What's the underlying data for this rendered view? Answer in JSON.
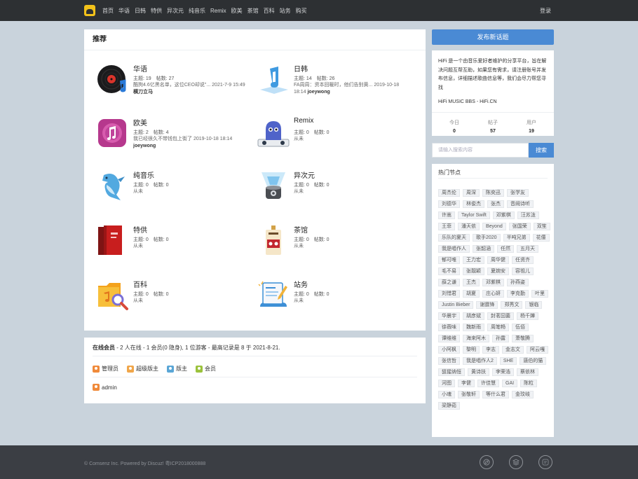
{
  "nav": {
    "items": [
      "首页",
      "华语",
      "日韩",
      "特供",
      "异次元",
      "纯音乐",
      "Remix",
      "欧美",
      "茶馆",
      "百科",
      "站务",
      "购买"
    ],
    "login": "登录"
  },
  "main": {
    "title": "推荐",
    "forums": [
      {
        "name": "华语",
        "stats": "主题: 19　帖数: 27",
        "last": "酷狗4.6亿黑名单，这位CEO却说\"... 2021-7-9 15:49",
        "user": "横刀立马",
        "icon": "vinyl-record-icon"
      },
      {
        "name": "日韩",
        "stats": "主题: 14　帖数: 26",
        "last": "FA周周：资本回暖时，他们告别黄... 2019-10-18 18:14",
        "user": "joeywong",
        "icon": "music-note-icon"
      },
      {
        "name": "欧美",
        "stats": "主题: 2　帖数: 4",
        "last": "我已经很久不带钱包上街了 2019-10-18 18:14",
        "user": "joeywong",
        "icon": "itunes-icon"
      },
      {
        "name": "Remix",
        "stats": "主题: 0　帖数: 0",
        "last": "从未",
        "user": "",
        "icon": "dj-ghost-icon"
      },
      {
        "name": "纯音乐",
        "stats": "主题: 0　帖数: 0",
        "last": "从未",
        "user": "",
        "icon": "dolphin-icon"
      },
      {
        "name": "异次元",
        "stats": "主题: 0　帖数: 0",
        "last": "从未",
        "user": "",
        "icon": "hologram-speaker-icon"
      },
      {
        "name": "特供",
        "stats": "主题: 0　帖数: 0",
        "last": "从未",
        "user": "",
        "icon": "red-book-icon"
      },
      {
        "name": "茶馆",
        "stats": "主题: 0　帖数: 0",
        "last": "从未",
        "user": "",
        "icon": "cassette-icon"
      },
      {
        "name": "百科",
        "stats": "主题: 0　帖数: 0",
        "last": "从未",
        "user": "",
        "icon": "folder-search-icon"
      },
      {
        "name": "站务",
        "stats": "主题: 0　帖数: 0",
        "last": "从未",
        "user": "",
        "icon": "document-pen-icon"
      }
    ]
  },
  "online": {
    "label": "在线会员",
    "summary": " - 2 人在线 - 1 会员(0 隐身), 1 位游客 - 最高记录是 8 于 2021-8-21.",
    "roles": [
      {
        "label": "管理员",
        "color": "#f08a3a"
      },
      {
        "label": "超级版主",
        "color": "#f0a64a"
      },
      {
        "label": "版主",
        "color": "#5aa6d6"
      },
      {
        "label": "会员",
        "color": "#9bc23c"
      }
    ],
    "member": "admin"
  },
  "sidebar": {
    "post_button": "发布新话题",
    "intro": "HiFi 是一个由音乐爱好者维护的分享平台，旨在解决问题互帮互助，如果您有需求，请注册账号并发布信息，详细描述歌曲信息等，我们会尽力帮您寻找",
    "site": "HiFi MUSIC BBS - HiFi.CN",
    "stats": [
      {
        "label": "今日",
        "value": "0"
      },
      {
        "label": "帖子",
        "value": "57"
      },
      {
        "label": "用户",
        "value": "19"
      }
    ],
    "search_placeholder": "请输入搜索内容",
    "search_button": "搜索",
    "hot_title": "热门节点",
    "tags": [
      "周杰伦",
      "周深",
      "陈奕迅",
      "张学友",
      "刘德华",
      "林俊杰",
      "张杰",
      "音阙诗听",
      "许嵩",
      "Taylor Swift",
      "邓紫棋",
      "汪苏泷",
      "王菲",
      "潘天依",
      "Beyond",
      "张国荣",
      "双笙",
      "乐队的夏天",
      "歌手2020",
      "半吨兄弟",
      "花僮",
      "我是唱作人",
      "张韶涵",
      "任然",
      "五月天",
      "郁可唯",
      "王力宏",
      "周华健",
      "任贤齐",
      "毛不易",
      "张靓颖",
      "夏婉安",
      "容祖儿",
      "薛之谦",
      "王杰",
      "邓紫棋",
      "孙燕姿",
      "刘惜君",
      "胡夏",
      "庄心妍",
      "李克勤",
      "叶里",
      "Justin Bieber",
      "谢霆锋",
      "郑秀文",
      "银临",
      "华晨宇",
      "胡彦斌",
      "封茗囧菌",
      "杨千嬅",
      "徐薇味",
      "魏新雨",
      "周笔畅",
      "伍佰",
      "谭维维",
      "海来阿木",
      "孙露",
      "萧敬腾",
      "小阿枫",
      "黎明",
      "李志",
      "金志文",
      "阿云嘎",
      "张信哲",
      "我是唱作人2",
      "SHE",
      "唐伯的猫",
      "狙猩纳恒",
      "黄诗扶",
      "李荣浩",
      "蔡依林",
      "河图",
      "李健",
      "许佳慧",
      "GAI",
      "陈粒",
      "小魂",
      "张敬轩",
      "等什么君",
      "金玟岐",
      "梁静茹"
    ]
  },
  "footer": {
    "copyright": "© Comsenz Inc.  Powered by Discuz!  粤ICP2018000888"
  }
}
